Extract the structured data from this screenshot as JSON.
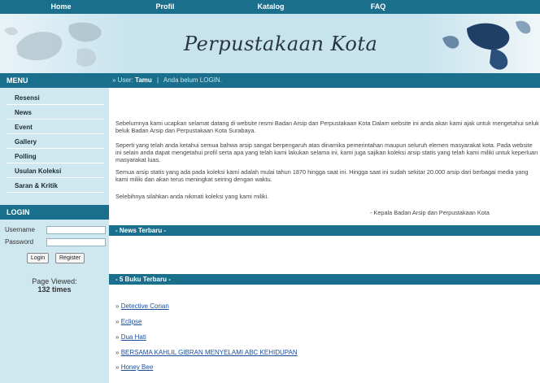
{
  "nav": {
    "items": [
      "Home",
      "Profil",
      "Katalog",
      "FAQ"
    ]
  },
  "banner": {
    "title": "Perpustakaan Kota"
  },
  "sidebar": {
    "menu_title": "MENU",
    "menu_items": [
      "Resensi",
      "News",
      "Event",
      "Gallery",
      "Polling",
      "Usulan Koleksi",
      "Saran & Kritik"
    ],
    "login_title": "LOGIN",
    "username_label": "Username",
    "password_label": "Password",
    "login_button": "Login",
    "register_button": "Register",
    "page_viewed_label": "Page Viewed:",
    "page_viewed_count": "132 times"
  },
  "userbar": {
    "prefix": "» User:",
    "username": "Tamu",
    "separator": "|",
    "status": "Anda belum LOGIN."
  },
  "welcome": {
    "paragraphs": [
      "Sebelumnya kami ucapkan selamat datang di website resmi Badan Arsip dan Perpustakaan Kota                    Dalam website ini anda akan kami ajak untuk mengetahui seluk beluk Badan Arsip dan Perpustakaan Kota Surabaya.",
      "Seperti yang telah anda ketahui semua bahwa arsip sangat berpengaruh atas dinamika pemerintahan maupun seluruh elemen masyarakat kota. Pada website ini selain anda dapat mengetahui profil serta apa yang telah kami lakukan selama ini, kami juga sajikan koleksi arsip statis yang telah kami miliki untuk keperluan masyarakat luas.",
      "Semua arsip statis yang ada pada koleksi kami adalah mulai tahun 1870 hingga saat ini. Hingga saat ini sudah sekitar 20.000 arsip dari berbagai media yang kami miliki dan akan terus meningkat seiring dengan waktu.",
      "Selebihnya silahkan anda nikmati koleksi yang kami miliki."
    ],
    "signature": "- Kepala Badan Arsip dan Perpustakaan Kota"
  },
  "news": {
    "title": "- News Terbaru -"
  },
  "books": {
    "title": "- 5 Buku Terbaru -",
    "arrow": "»",
    "items": [
      "Detective Conan",
      "Eclipse",
      "Dua Hati",
      "BERSAMA KAHLIL GIBRAN MENYELAMI ABC KEHIDUPAN",
      "Honey Bee"
    ]
  },
  "colors": {
    "nav_bg": "#1a6f8c",
    "banner_bg": "#c6e3ee",
    "sidebar_bg": "#cfe8f0",
    "link": "#1a4f9c"
  },
  "icons": {
    "left_decoration": "world-map-icon",
    "right_decoration": "globe-icon"
  }
}
